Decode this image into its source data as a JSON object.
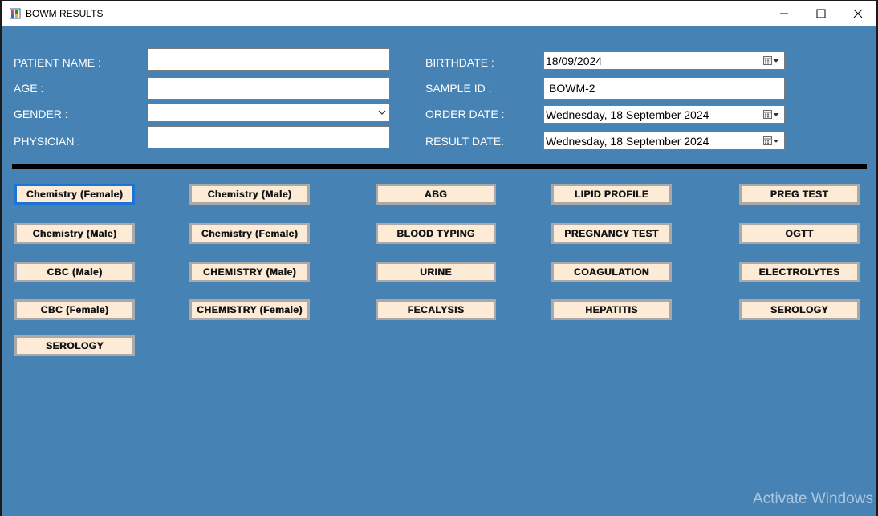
{
  "window": {
    "title": "BOWM RESULTS"
  },
  "form": {
    "patient_name": {
      "label": "PATIENT NAME :",
      "value": ""
    },
    "age": {
      "label": "AGE :",
      "value": ""
    },
    "gender": {
      "label": "GENDER :",
      "value": ""
    },
    "physician": {
      "label": "PHYSICIAN :",
      "value": ""
    },
    "birthdate": {
      "label": "BIRTHDATE :",
      "value": "18/09/2024"
    },
    "sample_id": {
      "label": "SAMPLE ID :",
      "value": "BOWM-2"
    },
    "order_date": {
      "label": "ORDER DATE :",
      "value": "Wednesday, 18 September 2024"
    },
    "result_date": {
      "label": "RESULT  DATE:",
      "value": "Wednesday, 18 September 2024"
    }
  },
  "tests": {
    "col1": [
      "Chemistry (Female)",
      "Chemistry (Male)",
      "CBC (Male)",
      "CBC (Female)",
      "SEROLOGY"
    ],
    "col2": [
      "Chemistry (Male)",
      "Chemistry (Female)",
      "CHEMISTRY (Male)",
      "CHEMISTRY (Female)"
    ],
    "col3": [
      "ABG",
      "BLOOD TYPING",
      "URINE",
      "FECALYSIS"
    ],
    "col4": [
      "LIPID PROFILE",
      "PREGNANCY TEST",
      "COAGULATION",
      "HEPATITIS"
    ],
    "col5": [
      "PREG TEST",
      "OGTT",
      "ELECTROLYTES",
      "SEROLOGY"
    ]
  },
  "watermark": "Activate Windows"
}
